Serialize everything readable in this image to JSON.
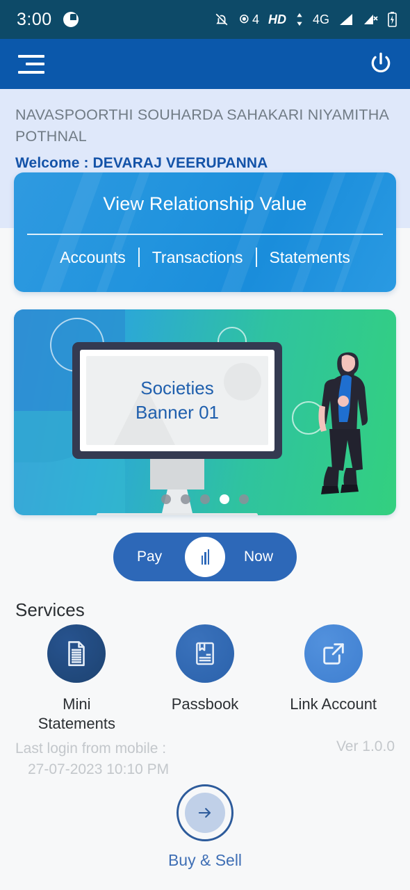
{
  "statusbar": {
    "time": "3:00",
    "app_icon": "app-badge-icon",
    "icons": [
      {
        "name": "bell-muted-icon"
      },
      {
        "name": "location-count-icon",
        "label": "4"
      },
      {
        "name": "hd-icon",
        "label": "HD"
      },
      {
        "name": "data-transfer-icon"
      },
      {
        "name": "network-type-label",
        "label": "4G"
      },
      {
        "name": "signal-bars-icon"
      },
      {
        "name": "signal-off-icon"
      },
      {
        "name": "battery-charging-icon"
      }
    ]
  },
  "appbar": {
    "menu_icon": "hamburger-menu-icon",
    "power_icon": "power-icon"
  },
  "header": {
    "bank_name": "NAVASPOORTHI SOUHARDA SAHAKARI NIYAMITHA POTHNAL",
    "welcome": "Welcome : DEVARAJ VEERUPANNA"
  },
  "relationship_card": {
    "title": "View Relationship Value",
    "links": [
      "Accounts",
      "Transactions",
      "Statements"
    ]
  },
  "banner": {
    "line1": "Societies",
    "line2": "Banner 01",
    "dots_total": 5,
    "active_dot": 4
  },
  "paynow": {
    "left_label": "Pay",
    "right_label": "Now",
    "knob_icon": "scan-barcode-icon"
  },
  "services": {
    "title": "Services",
    "items": [
      {
        "label": "Mini\nStatements",
        "label_line1": "Mini",
        "label_line2": "Statements",
        "icon": "document-lines-icon"
      },
      {
        "label": "Passbook",
        "label_line1": "Passbook",
        "label_line2": "",
        "icon": "passbook-book-icon"
      },
      {
        "label": "Link Account",
        "label_line1": "Link Account",
        "label_line2": "",
        "icon": "external-link-icon"
      }
    ]
  },
  "footer": {
    "last_login_label": "Last login from mobile :",
    "last_login_value": "27-07-2023 10:10 PM",
    "version": "Ver 1.0.0",
    "buy_sell_label": "Buy & Sell",
    "buy_sell_icon": "arrow-right-icon"
  },
  "colors": {
    "statusbar_bg": "#0d4a68",
    "appbar_bg": "#0b58ab",
    "header_bg": "#dfe8fa",
    "page_bg": "#f7f8f9",
    "accent_blue": "#1453a8",
    "card_blue": "#2294de",
    "paynow_blue": "#2d68b8",
    "muted_text": "#c3c7cb"
  }
}
